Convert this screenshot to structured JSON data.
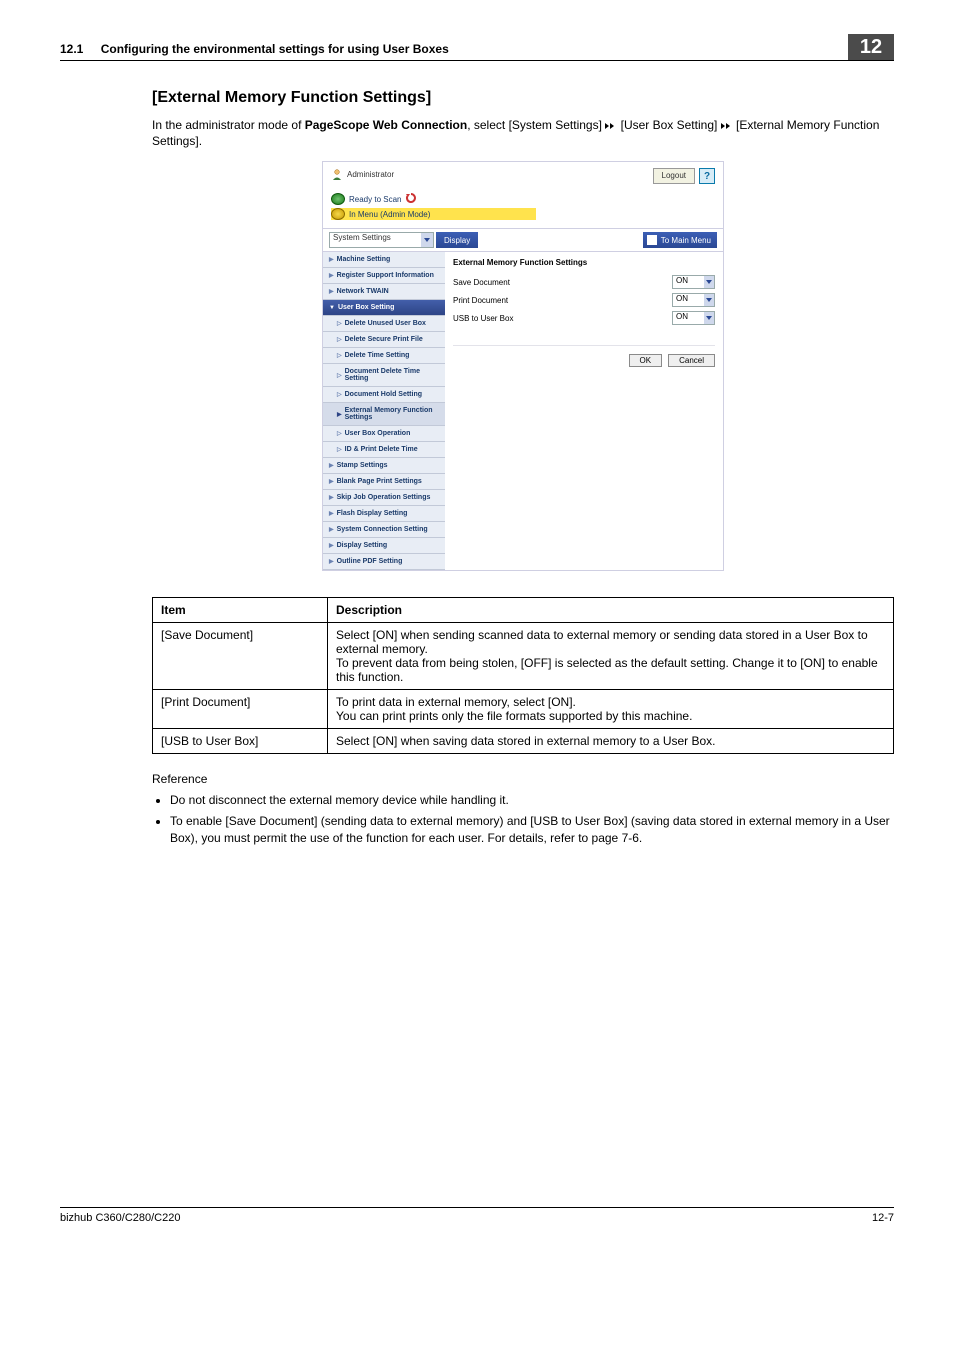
{
  "header": {
    "section_number": "12.1",
    "section_title": "Configuring the environmental settings for using User Boxes",
    "chapter_number": "12"
  },
  "section": {
    "heading": "[External Memory Function Settings]",
    "intro_prefix": "In the administrator mode of ",
    "product": "PageScope Web Connection",
    "intro_mid": ", select [System Settings] ",
    "intro_mid2": " [User Box Setting] ",
    "intro_tail": " [External Memory Function Settings]."
  },
  "shot": {
    "role": "Administrator",
    "logout": "Logout",
    "help": "?",
    "status_ready": "Ready to Scan",
    "status_admin": "In Menu (Admin Mode)",
    "dropdown": "System Settings",
    "display": "Display",
    "to_main": "To Main Menu",
    "sidebar": [
      {
        "type": "top",
        "label": "Machine Setting"
      },
      {
        "type": "top",
        "label": "Register Support Information"
      },
      {
        "type": "top",
        "label": "Network TWAIN"
      },
      {
        "type": "active",
        "label": "User Box Setting"
      },
      {
        "type": "sub",
        "label": "Delete Unused User Box"
      },
      {
        "type": "sub",
        "label": "Delete Secure Print File"
      },
      {
        "type": "sub",
        "label": "Delete Time Setting"
      },
      {
        "type": "sub",
        "label": "Document Delete Time Setting"
      },
      {
        "type": "sub",
        "label": "Document Hold Setting"
      },
      {
        "type": "sel",
        "label": "External Memory Function Settings"
      },
      {
        "type": "sub",
        "label": "User Box Operation"
      },
      {
        "type": "sub",
        "label": "ID & Print Delete Time"
      },
      {
        "type": "top",
        "label": "Stamp Settings"
      },
      {
        "type": "top",
        "label": "Blank Page Print Settings"
      },
      {
        "type": "top",
        "label": "Skip Job Operation Settings"
      },
      {
        "type": "top",
        "label": "Flash Display Setting"
      },
      {
        "type": "top",
        "label": "System Connection Setting"
      },
      {
        "type": "top",
        "label": "Display Setting"
      },
      {
        "type": "top",
        "label": "Outline PDF Setting"
      }
    ],
    "panel_title": "External Memory Function Settings",
    "rows": [
      {
        "label": "Save Document",
        "value": "ON"
      },
      {
        "label": "Print Document",
        "value": "ON"
      },
      {
        "label": "USB to User Box",
        "value": "ON"
      }
    ],
    "ok": "OK",
    "cancel": "Cancel"
  },
  "table": {
    "head_item": "Item",
    "head_desc": "Description",
    "rows": [
      {
        "item": "[Save Document]",
        "desc": "Select [ON] when sending scanned data to external memory or sending data stored in a User Box to external memory.\nTo prevent data from being stolen, [OFF] is selected as the default setting. Change it to [ON] to enable this function."
      },
      {
        "item": "[Print Document]",
        "desc": "To print data in external memory, select [ON].\nYou can print prints only the file formats supported by this machine."
      },
      {
        "item": "[USB to User Box]",
        "desc": "Select [ON] when saving data stored in external memory to a User Box."
      }
    ]
  },
  "reference": {
    "title": "Reference",
    "items": [
      "Do not disconnect the external memory device while handling it.",
      "To enable [Save Document] (sending data to external memory) and [USB to User Box] (saving data stored in external memory in a User Box), you must permit the use of the function for each user. For details, refer to page 7-6."
    ]
  },
  "footer": {
    "left": "bizhub C360/C280/C220",
    "right": "12-7"
  }
}
